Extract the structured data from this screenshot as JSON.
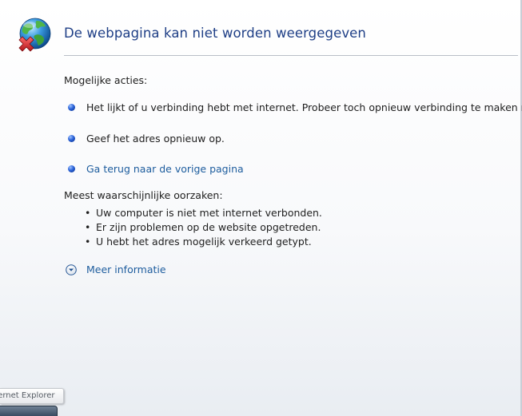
{
  "page": {
    "title": "De webpagina kan niet worden weergegeven",
    "icon": "globe-error-icon"
  },
  "actions": {
    "heading": "Mogelijke acties:",
    "items": [
      {
        "text": "Het lijkt of u verbinding hebt met internet. Probeer toch opnieuw verbinding te maken met",
        "is_link": false
      },
      {
        "text": "Geef het adres opnieuw op.",
        "is_link": false
      },
      {
        "text": "Ga terug naar de vorige pagina",
        "is_link": true
      }
    ]
  },
  "causes": {
    "heading": "Meest waarschijnlijke oorzaken:",
    "items": [
      "Uw computer is niet met internet verbonden.",
      "Er zijn problemen op de website opgetreden.",
      "U hebt het adres mogelijk verkeerd getypt."
    ]
  },
  "more_info": {
    "label": "Meer informatie",
    "icon": "chevron-down-circle-icon"
  },
  "taskbar": {
    "tooltip": "Internet Explorer"
  },
  "colors": {
    "title": "#1f3f86",
    "link": "#1e5d9e",
    "bullet": "#2a62d8",
    "error_x": "#d7262b"
  }
}
